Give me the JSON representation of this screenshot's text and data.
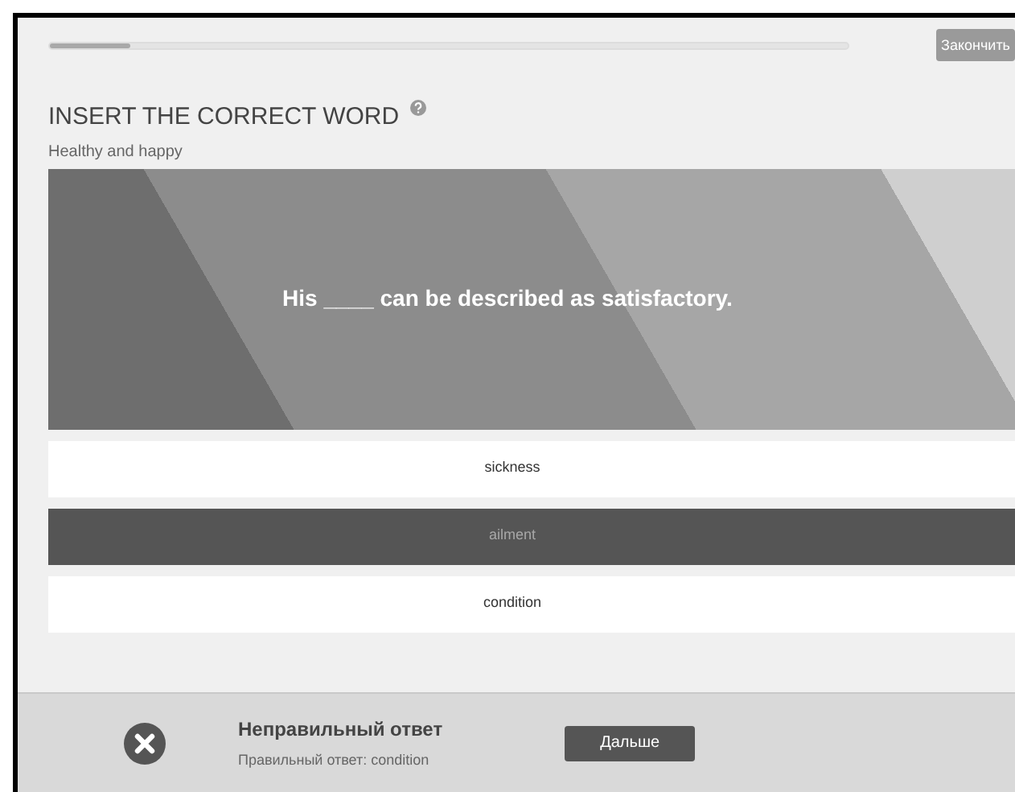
{
  "progress": {
    "level": 0.1
  },
  "finish_button": "Закончить",
  "title": "INSERT THE CORRECT WORD",
  "subtitle": "Healthy and happy",
  "question": "His ____ can be described as satisfactory.",
  "options": [
    {
      "label": "sickness",
      "selected": false
    },
    {
      "label": "ailment",
      "selected": true
    },
    {
      "label": "condition",
      "selected": false
    }
  ],
  "feedback": {
    "title": "Неправильный ответ",
    "detail": "Правильный ответ: condition",
    "button": "Дальше"
  }
}
